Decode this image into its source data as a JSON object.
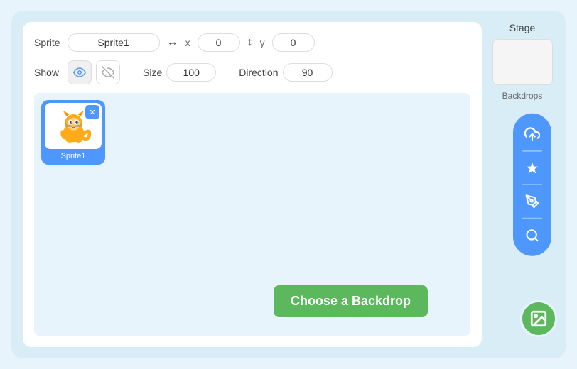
{
  "sprite": {
    "label": "Sprite",
    "name": "Sprite1",
    "x_icon": "↔",
    "x_label": "x",
    "x_value": "0",
    "y_icon": "↕",
    "y_label": "y",
    "y_value": "0"
  },
  "controls": {
    "show_label": "Show",
    "size_label": "Size",
    "size_value": "100",
    "direction_label": "Direction",
    "direction_value": "90"
  },
  "stage": {
    "label": "Stage",
    "backdrops_label": "Backdrops"
  },
  "canvas": {
    "sprite_card_label": "Sprite1"
  },
  "buttons": {
    "choose_backdrop": "Choose a Backdrop",
    "delete_icon": "✕",
    "upload_icon": "⬆",
    "magic_icon": "✦",
    "paint_icon": "✏",
    "search_icon": "🔍",
    "image_icon": "🖼"
  }
}
